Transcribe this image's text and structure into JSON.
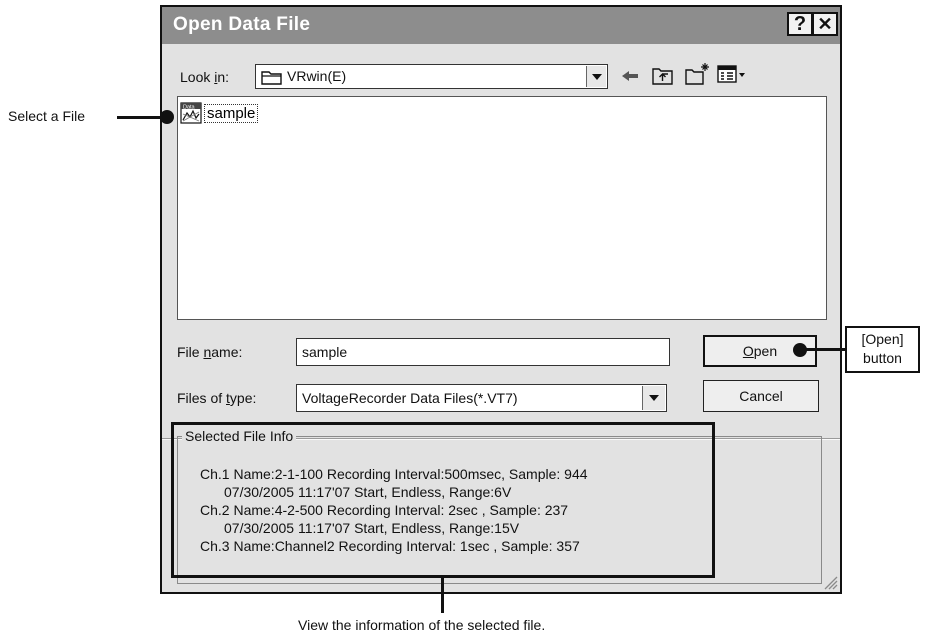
{
  "window": {
    "title": "Open Data File",
    "help_button": "?",
    "close_button": "✕"
  },
  "toolbar": {
    "look_in_prefix": "Look ",
    "look_in_mnemonic": "i",
    "look_in_suffix": "n:",
    "look_in_value": "VRwin(E)"
  },
  "file_list": {
    "items": [
      {
        "name": "sample",
        "icon_badge": "Data"
      }
    ]
  },
  "file_name": {
    "label_prefix": "File ",
    "label_mnemonic": "n",
    "label_suffix": "ame:",
    "value": "sample"
  },
  "file_type": {
    "label_prefix": "Files of ",
    "label_mnemonic": "t",
    "label_suffix": "ype:",
    "value": "VoltageRecorder Data Files(*.VT7)"
  },
  "buttons": {
    "open_mnemonic": "O",
    "open_rest": "pen",
    "cancel": "Cancel"
  },
  "selected_file_info": {
    "legend": "Selected File Info",
    "lines": [
      "Ch.1 Name:2-1-100   Recording Interval:500msec, Sample: 944",
      "07/30/2005 11:17'07 Start, Endless, Range:6V",
      "Ch.2 Name:4-2-500   Recording Interval:  2sec , Sample: 237",
      "07/30/2005 11:17'07 Start, Endless, Range:15V",
      "Ch.3 Name:Channel2  Recording Interval:  1sec , Sample: 357"
    ]
  },
  "annotations": {
    "select_file": "Select a File",
    "open_button_line1": "[Open]",
    "open_button_line2": "button",
    "view_info": "View the information of the selected file."
  }
}
